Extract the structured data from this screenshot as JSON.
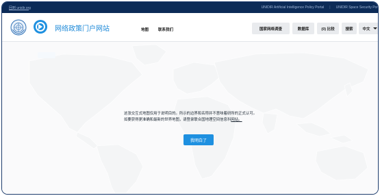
{
  "topbar": {
    "back_link": "回到 unidir.org",
    "portal_link": "UNIDIR Artificial Intelligence Policy Portal",
    "separator": "|",
    "space_link": "UNIDIR Space Security Por"
  },
  "header": {
    "site_title": "网络政策门户网站",
    "nav": [
      "地图",
      "联系我们"
    ],
    "buttons": {
      "survey": "国家网络调查",
      "database": "数据库",
      "compare": "(0) 比较",
      "search": "搜索",
      "language": "中文"
    }
  },
  "map": {
    "land_color": "#e6e8eb",
    "background_color": "#f3f4f6"
  },
  "dialog": {
    "text": "这张交互式地图仅用于说明目的。所示的边界和名称并不意味着研所的正式认可。如要获得更准确和最新的世界地图，请登录联合国地理空间信息科",
    "link": "网站。",
    "ok_label": "我明白了"
  },
  "colors": {
    "brand_blue": "#1e90e0",
    "top_strip": "#0c2b57",
    "title_blue": "#1f8ad8"
  }
}
